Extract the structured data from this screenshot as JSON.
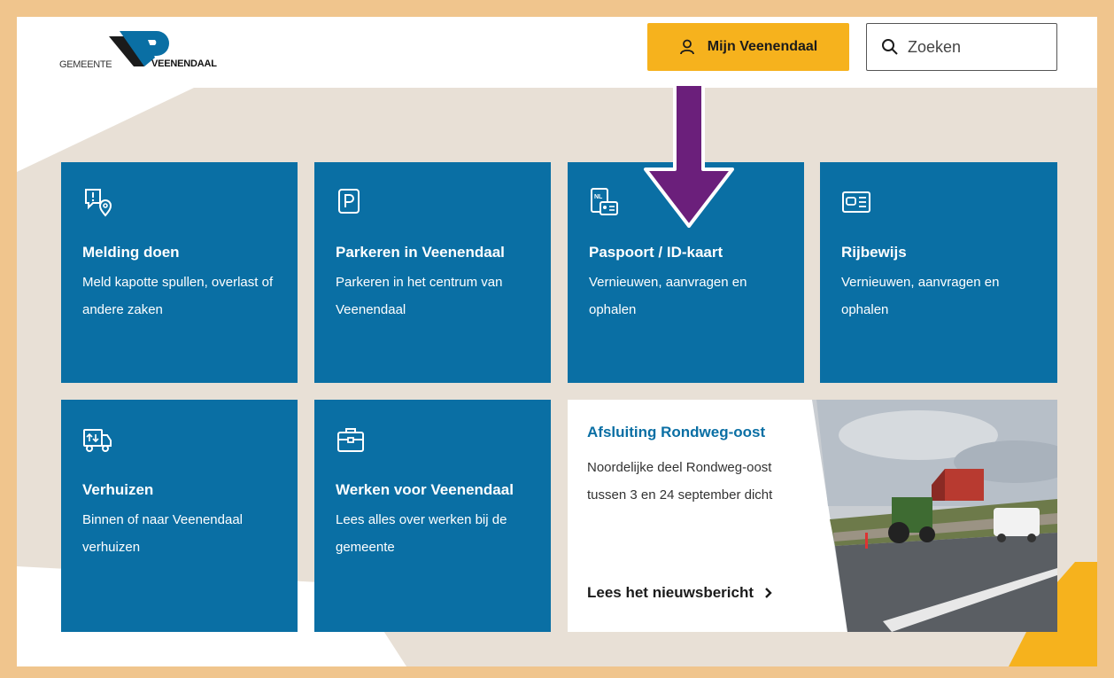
{
  "header": {
    "logo": {
      "left_text": "GEMEENTE",
      "right_text": "VEENENDAAL"
    },
    "account_button_label": "Mijn Veenendaal",
    "search_placeholder": "Zoeken"
  },
  "tiles": [
    {
      "icon": "report-location-icon",
      "title": "Melding doen",
      "description": "Meld kapotte spullen, overlast of andere zaken"
    },
    {
      "icon": "parking-icon",
      "title": "Parkeren in Veenendaal",
      "description": "Parkeren in het centrum van Veenendaal"
    },
    {
      "icon": "passport-id-icon",
      "title": "Paspoort / ID-kaart",
      "description": "Vernieuwen, aanvragen en ophalen"
    },
    {
      "icon": "drivers-license-icon",
      "title": "Rijbewijs",
      "description": "Vernieuwen, aanvragen en ophalen"
    },
    {
      "icon": "moving-truck-icon",
      "title": "Verhuizen",
      "description": "Binnen of naar Veenendaal verhuizen"
    },
    {
      "icon": "briefcase-icon",
      "title": "Werken voor Veenendaal",
      "description": "Lees alles over werken bij de gemeente"
    }
  ],
  "news": {
    "title": "Afsluiting Rondweg-oost",
    "description": "Noordelijke deel Rondweg-oost tussen 3 en 24 september dicht",
    "link_label": "Lees het nieuwsbericht"
  },
  "colors": {
    "frame_border": "#f0c58d",
    "tile_blue": "#0a6fa4",
    "accent_yellow": "#f6b21d",
    "annotation_arrow": "#6b1f7b",
    "background_shape": "#e8e0d6"
  }
}
